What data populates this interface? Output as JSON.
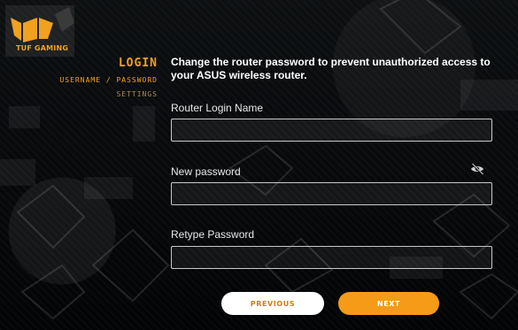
{
  "brand": {
    "logo_text": "TUF GAMING",
    "accent_color": "#f0a11e"
  },
  "sidebar": {
    "steps": [
      {
        "label": "LOGIN",
        "state": "active"
      },
      {
        "label": "USERNAME / PASSWORD",
        "state": "active"
      },
      {
        "label": "SETTINGS",
        "state": "pending"
      }
    ]
  },
  "form": {
    "headline": "Change the router password to prevent unauthorized access to your ASUS wireless router.",
    "router_login_name": {
      "label": "Router Login Name",
      "value": "",
      "placeholder": ""
    },
    "new_password": {
      "label": "New password",
      "value": "",
      "placeholder": "",
      "toggle_icon": "eye-slash-icon"
    },
    "retype_password": {
      "label": "Retype Password",
      "value": "",
      "placeholder": ""
    }
  },
  "buttons": {
    "previous": "PREVIOUS",
    "next": "NEXT"
  }
}
